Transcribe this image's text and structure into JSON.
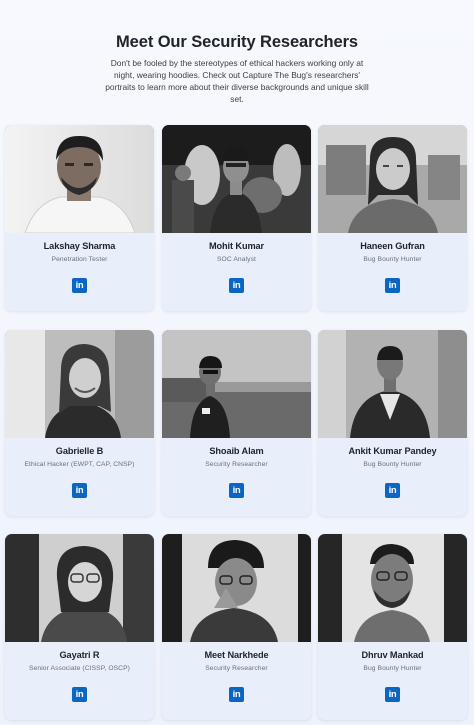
{
  "section": {
    "title": "Meet Our Security Researchers",
    "subtitle": "Don't be fooled by the stereotypes of ethical hackers working only at night, wearing hoodies. Check out Capture The Bug's researchers' portraits to learn more about their diverse backgrounds and unique skill set."
  },
  "researchers": [
    {
      "name": "Lakshay Sharma",
      "role": "Penetration Tester",
      "linkedin_label": "in"
    },
    {
      "name": "Mohit Kumar",
      "role": "SOC Analyst",
      "linkedin_label": "in"
    },
    {
      "name": "Haneen Gufran",
      "role": "Bug Bounty Hunter",
      "linkedin_label": "in"
    },
    {
      "name": "Gabrielle B",
      "role": "Ethical Hacker (EWPT, CAP, CNSP)",
      "linkedin_label": "in"
    },
    {
      "name": "Shoaib Alam",
      "role": "Security Researcher",
      "linkedin_label": "in"
    },
    {
      "name": "Ankit Kumar Pandey",
      "role": "Bug Bounty Hunter",
      "linkedin_label": "in"
    },
    {
      "name": "Gayatri R",
      "role": "Senior Associate (CISSP, OSCP)",
      "linkedin_label": "in"
    },
    {
      "name": "Meet Narkhede",
      "role": "Security Researcher",
      "linkedin_label": "in"
    },
    {
      "name": "Dhruv Mankad",
      "role": "Bug Bounty Hunter",
      "linkedin_label": "in"
    }
  ],
  "colors": {
    "linkedin": "#0a66c2",
    "card_background": "#e9eefb",
    "page_background": "#f4f7fd"
  },
  "icons": {
    "linkedin": "linkedin-icon"
  }
}
